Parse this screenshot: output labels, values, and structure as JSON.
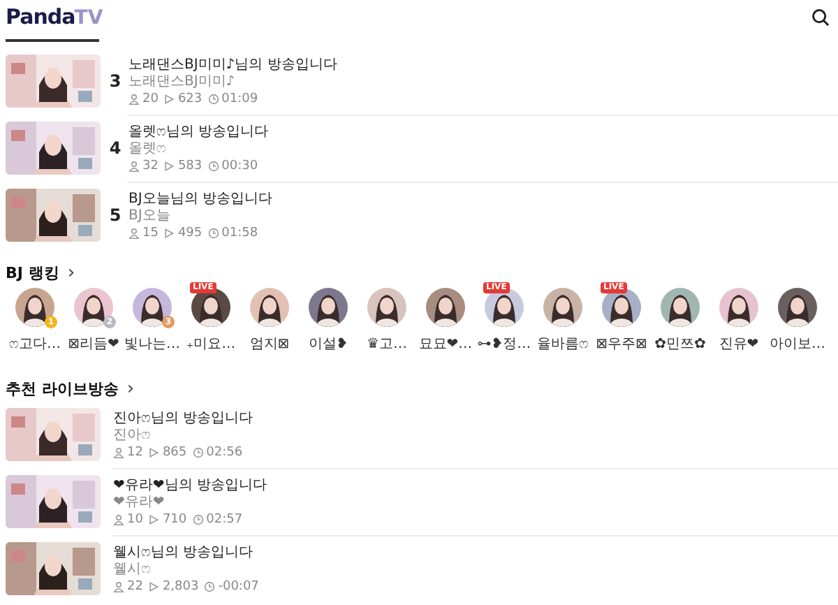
{
  "header": {
    "logo_main": "Panda",
    "logo_accent": "TV"
  },
  "top_list": [
    {
      "rank": "3",
      "title": "노래댄스BJ미미♪님의 방송입니다",
      "streamer": "노래댄스BJ미미♪",
      "viewers": "20",
      "plays": "623",
      "duration": "01:09"
    },
    {
      "rank": "4",
      "title": "올렛ෆ님의 방송입니다",
      "streamer": "올렛ෆ",
      "viewers": "32",
      "plays": "583",
      "duration": "00:30"
    },
    {
      "rank": "5",
      "title": "BJ오늘님의 방송입니다",
      "streamer": "BJ오늘",
      "viewers": "15",
      "plays": "495",
      "duration": "01:58"
    }
  ],
  "ranking": {
    "heading": "BJ 랭킹",
    "more": "›",
    "items": [
      {
        "name": "ෆ고다…",
        "medal": {
          "label": "1",
          "color": "#f2b51d"
        }
      },
      {
        "name": "⊠리듬❤",
        "medal": {
          "label": "2",
          "color": "#b9b9c2"
        }
      },
      {
        "name": "빛나는…",
        "medal": {
          "label": "3",
          "color": "#e39a62"
        }
      },
      {
        "name": "₊미요…",
        "live_badge": "LIVE"
      },
      {
        "name": "엄지⊠"
      },
      {
        "name": "이설❥"
      },
      {
        "name": "♛고…"
      },
      {
        "name": "묘묘❤…"
      },
      {
        "name": "⊶❥정…",
        "live_badge": "LIVE"
      },
      {
        "name": "율바름ෆ"
      },
      {
        "name": "⊠우주⊠",
        "live_badge": "LIVE"
      },
      {
        "name": "✿민쯔✿"
      },
      {
        "name": "진유❤"
      },
      {
        "name": "아이보…"
      }
    ]
  },
  "recommended": {
    "heading": "추천 라이브방송",
    "more": "›",
    "items": [
      {
        "title": "진아ෆ님의 방송입니다",
        "streamer": "진아ෆ",
        "viewers": "12",
        "plays": "865",
        "duration": "02:56"
      },
      {
        "title": "❤유라❤님의 방송입니다",
        "streamer": "❤유라❤",
        "viewers": "10",
        "plays": "710",
        "duration": "02:57"
      },
      {
        "title": "웰시ෆ님의 방송입니다",
        "streamer": "웰시ෆ",
        "viewers": "22",
        "plays": "2,803",
        "duration": "-00:07"
      }
    ]
  }
}
